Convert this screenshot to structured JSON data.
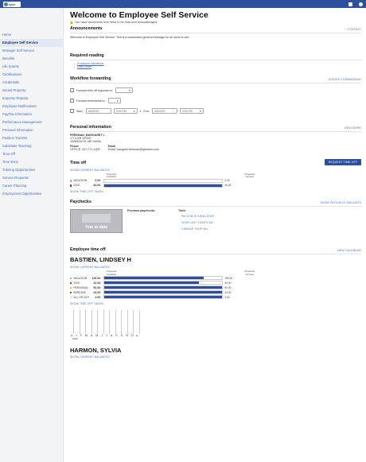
{
  "topbar": {
    "logo_text": "tyler",
    "icons": [
      "notifications-icon",
      "user-icon"
    ]
  },
  "sidebar": {
    "items": [
      "Home",
      "Employee Self Service",
      "Manager Self Service",
      "Benefits",
      "Life Events",
      "Certifications",
      "Credentials",
      "Issued Property",
      "Expense Reports",
      "Employee Notifications",
      "Pay/Tax Information",
      "Performance Management",
      "Personal Information",
      "Position Transfer",
      "Substitute Teaching",
      "Time Off",
      "Time Entry",
      "Training Opportunities",
      "Service Requests",
      "Career Planning",
      "Employment Opportunities"
    ],
    "active_index": 1
  },
  "page": {
    "title": "Welcome to Employee Self Service",
    "notice": "You have documents that need to be read and acknowledged."
  },
  "announcements": {
    "title": "Announcements",
    "link": "CONTACT",
    "text": "Welcome to Employee Self Service. This is a customized general message for all users to see."
  },
  "required_reading": {
    "title": "Required reading",
    "links": [
      "Employee Handbook",
      "Offer Letter"
    ]
  },
  "workflow": {
    "title": "Workflow forwarding",
    "link": "UPDATE FORWARDING",
    "forward_time_off": "Forward time off requests to:",
    "forward_timesheets": "Forward timesheets to:",
    "start_label": "Start:",
    "start_date": "4/6/2020",
    "start_time": "3:00 PM",
    "end_label": "End:",
    "end_date": "4/6/2020",
    "end_time": "3:00 PM"
  },
  "personal": {
    "title": "Personal information",
    "link": "VIEW MORE",
    "name": "FREEMAN, MARGARET L",
    "address1": "1 TYLER DRIVE",
    "address2": "YARMOUTH, ME 04096",
    "phone_label": "Phone",
    "phone": "OFFICE: 207-772-1000",
    "email_label": "Email",
    "email": "Email: margaret.freeman@tylertech.com"
  },
  "time_off": {
    "title": "Time off",
    "button": "REQUEST TIME OFF",
    "show_balances": "SHOW CURRENT BALANCES",
    "show_taken": "SHOW TIME OFF TAKEN",
    "col_available": "Projected Available",
    "col_earned": "Projected Earned",
    "rows": [
      {
        "name": "VACATION",
        "value": "0.00",
        "end": "0.00",
        "color": "#8fb3e8",
        "fill": 0
      },
      {
        "name": "SICK",
        "value": "40.00",
        "end": "40.00",
        "color": "#c62828",
        "fill": 1
      }
    ]
  },
  "paychecks": {
    "title": "Paychecks",
    "link": "SHOW PAYCHECK AMOUNTS",
    "col_previous": "Previous paychecks",
    "col_tools": "Tools",
    "year_to_date": "Year to date",
    "tools": [
      "PAYCHECK SIMULATOR",
      "VIEW LAST YEAR'S W2",
      "CHANGE YOUR W4"
    ]
  },
  "employee_time_off": {
    "title": "Employee time off",
    "link": "VIEW CALENDAR",
    "employees": [
      {
        "name": "BASTIEN, LINDSEY H",
        "show_balances": "SHOW CURRENT BALANCES",
        "show_taken": "SHOW TIME OFF TAKEN",
        "rows": [
          {
            "name": "VACATION",
            "value": "126.00",
            "end": "150.00",
            "color": "#8fb3e8",
            "fill": 0.84
          },
          {
            "name": "SICK",
            "value": "32.00",
            "end": "40.00",
            "color": "#c62828",
            "fill": 0.8
          },
          {
            "name": "PERSONAL",
            "value": "50.00",
            "end": "50.00",
            "color": "#f3c623",
            "fill": 1
          },
          {
            "name": "BEREAVE",
            "value": "24.00",
            "end": "24.00",
            "color": "#2e7d32",
            "fill": 1
          },
          {
            "name": "ALL OR NOT",
            "value": "4.00",
            "end": "4.00",
            "color": "#ddd",
            "fill": 1
          }
        ],
        "months": [
          "J",
          "F",
          "M",
          "A",
          "M",
          "J",
          "J",
          "A",
          "S",
          "O",
          "N",
          "D"
        ],
        "year": "2020"
      },
      {
        "name": "HARMON, SYLVIA",
        "show_balances": "SHOW CURRENT BALANCES"
      }
    ]
  }
}
